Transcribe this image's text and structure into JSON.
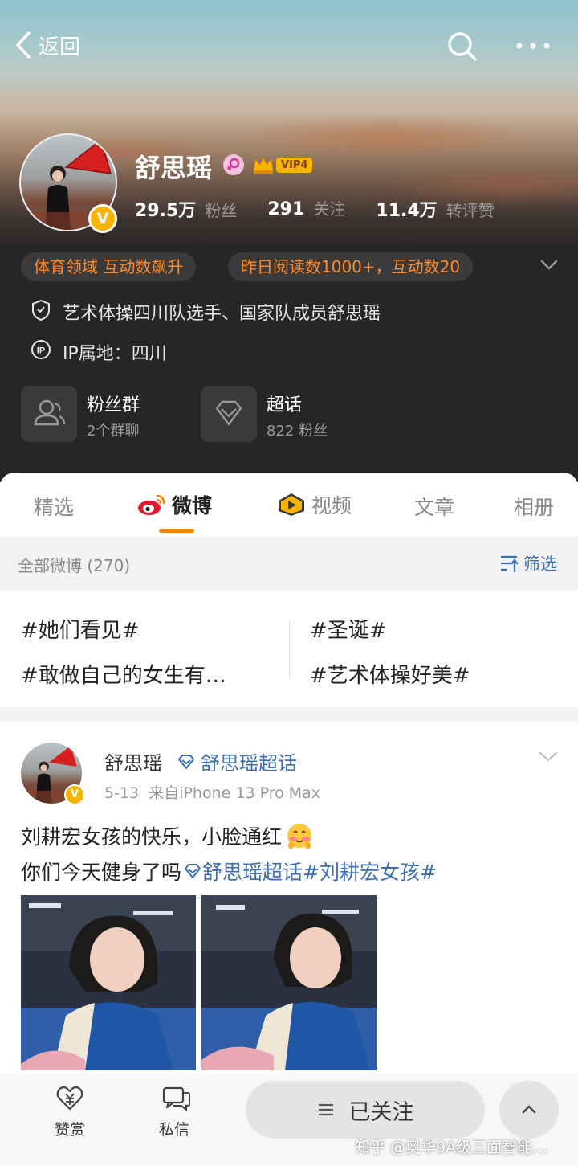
{
  "nav": {
    "back_label": "返回"
  },
  "profile": {
    "name": "舒思瑶",
    "vip_label": "VIP4",
    "verified_mark": "V",
    "stats": [
      {
        "value": "29.5万",
        "label": "粉丝"
      },
      {
        "value": "291",
        "label": "关注"
      },
      {
        "value": "11.4万",
        "label": "转评赞"
      }
    ],
    "badges": [
      "体育领域 互动数飙升",
      "昨日阅读数1000+，互动数20"
    ],
    "description": "艺术体操四川队选手、国家队成员舒思瑶",
    "ip_location": "IP属地：四川",
    "features": [
      {
        "title": "粉丝群",
        "subtitle": "2个群聊"
      },
      {
        "title": "超话",
        "subtitle": "822 粉丝"
      }
    ]
  },
  "tabs": [
    "精选",
    "微博",
    "视频",
    "文章",
    "相册"
  ],
  "active_tab": "微博",
  "feed": {
    "count_label": "全部微博 (270)",
    "filter_label": "筛选"
  },
  "topics": [
    "#她们看见#",
    "#圣诞#",
    "#敢做自己的女生有…",
    "#艺术体操好美#"
  ],
  "post": {
    "author": "舒思瑶",
    "super_topic": "舒思瑶超话",
    "meta": "5-13  来自iPhone 13 Pro Max",
    "line1": "刘耕宏女孩的快乐，小脸通红",
    "line2_plain": "你们今天健身了吗",
    "line2_topic": "舒思瑶超话",
    "line2_hashtag": "#刘耕宏女孩#"
  },
  "bottom": {
    "reward_label": "赞赏",
    "message_label": "私信",
    "follow_label": "已关注",
    "watermark": "知乎 @奥华9A级三面智能…"
  },
  "colors": {
    "accent": "#ff8200",
    "link": "#3a6fb7",
    "badge_text": "#ff8a2a",
    "vip_gold": "#f7b500"
  },
  "icons": [
    "chevron-left-icon",
    "search-icon",
    "more-icon",
    "female-icon",
    "crown-icon",
    "verified-icon",
    "chevron-down-icon",
    "shield-icon",
    "ip-icon",
    "group-icon",
    "diamond-icon",
    "weibo-icon",
    "video-icon",
    "filter-icon",
    "reward-icon",
    "message-icon",
    "menu-icon",
    "chevron-up-icon",
    "emoji-icon"
  ]
}
